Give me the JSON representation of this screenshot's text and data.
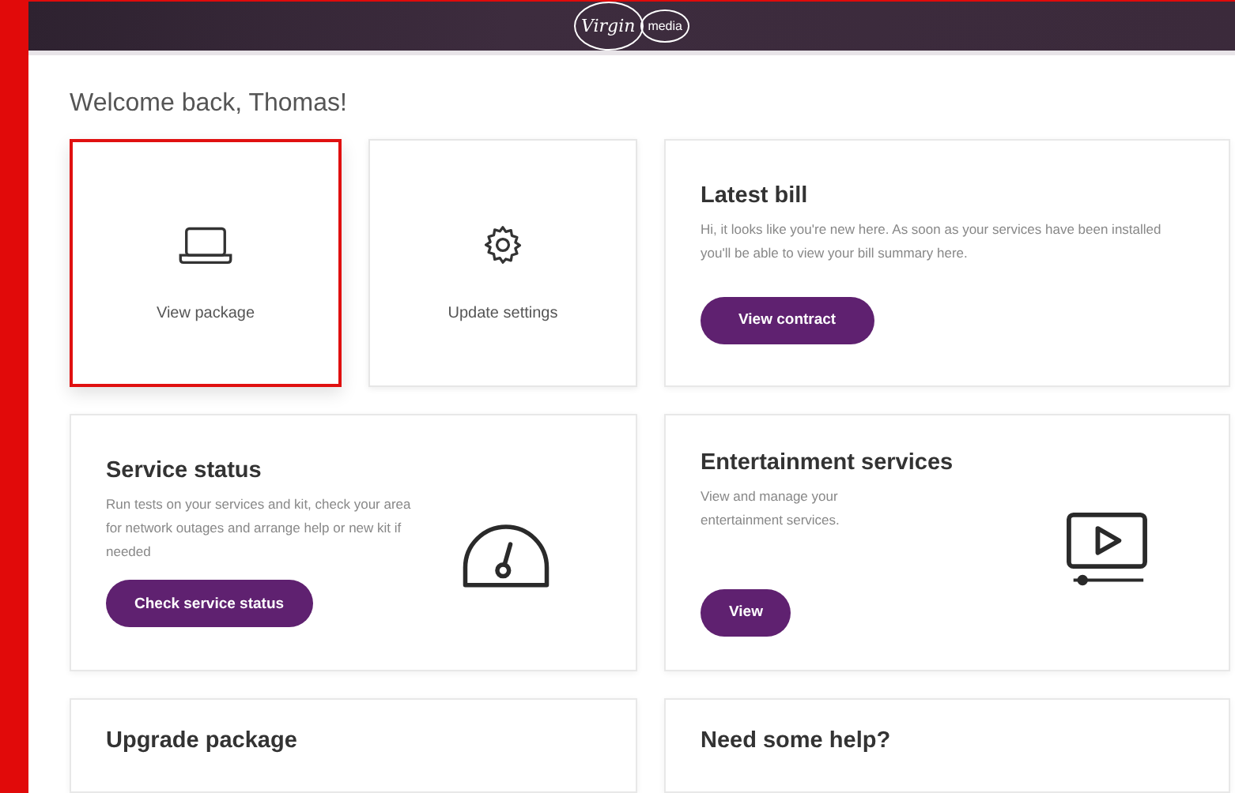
{
  "logo": {
    "left": "Virgin",
    "right": "media"
  },
  "greeting": "Welcome back, Thomas!",
  "tiles": [
    {
      "label": "View package",
      "highlighted": true
    },
    {
      "label": "Update settings",
      "highlighted": false
    }
  ],
  "cards": [
    {
      "title": "Latest bill",
      "text": "Hi, it looks like you're new here. As soon as your services have been installed you'll be able to view your bill summary here.",
      "button": "View contract"
    },
    {
      "title": "Service status",
      "text": "Run tests on your services and kit, check your area for network outages and arrange help or new kit if needed",
      "button": "Check service status"
    },
    {
      "title": "Entertainment services",
      "text": "View and manage your entertainment services.",
      "button": "View"
    },
    {
      "title": "Upgrade package"
    },
    {
      "title": "Need some help?"
    }
  ]
}
